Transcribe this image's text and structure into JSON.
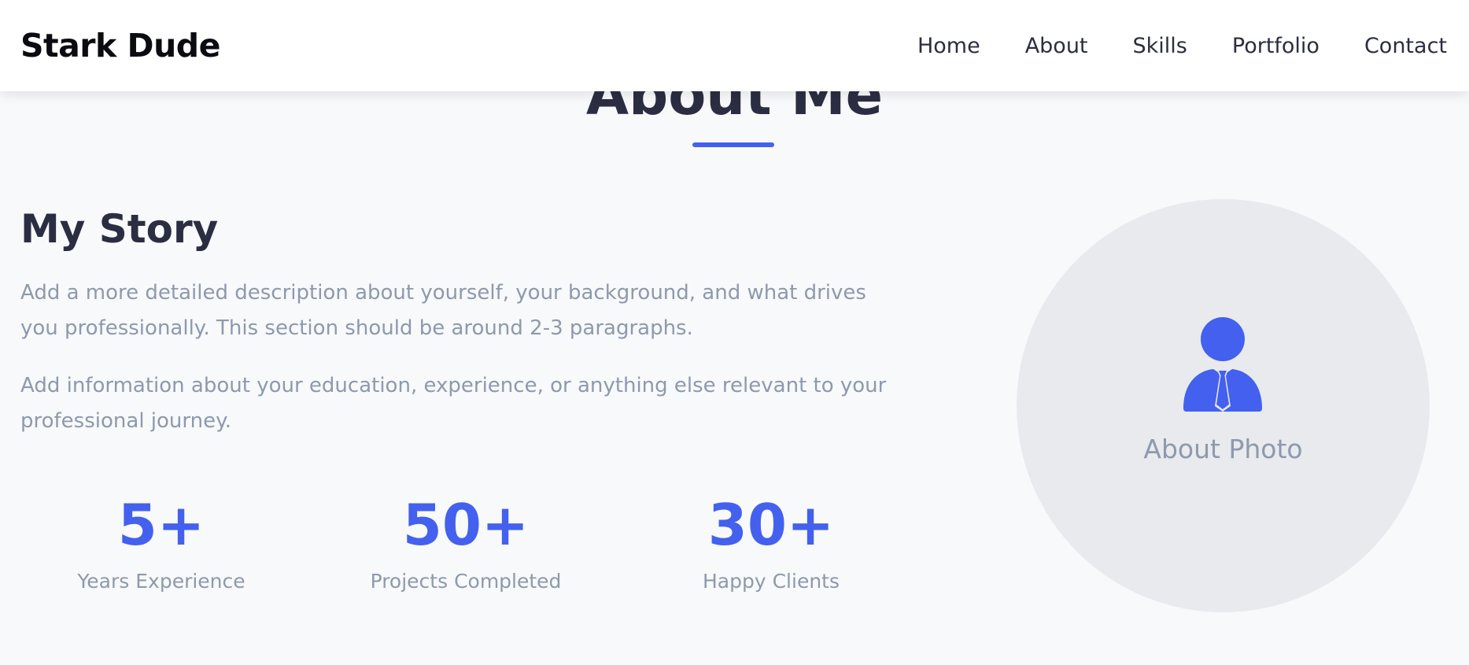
{
  "header": {
    "brand": "Stark Dude",
    "nav": [
      "Home",
      "About",
      "Skills",
      "Portfolio",
      "Contact"
    ]
  },
  "section": {
    "title": "About Me"
  },
  "story": {
    "heading": "My Story",
    "paragraphs": [
      "Add a more detailed description about yourself, your background, and what drives you professionally. This section should be around 2-3 paragraphs.",
      "Add information about your education, experience, or anything else relevant to your professional journey."
    ]
  },
  "stats": [
    {
      "value": "5+",
      "label": "Years Experience"
    },
    {
      "value": "50+",
      "label": "Projects Completed"
    },
    {
      "value": "30+",
      "label": "Happy Clients"
    }
  ],
  "photo": {
    "label": "About Photo",
    "icon": "user-tie-icon"
  },
  "colors": {
    "accent": "#4361ee",
    "heading": "#2b2d42",
    "muted": "#8d99ae",
    "background": "#f8f9fb",
    "photo_bg": "#e8eaed"
  }
}
